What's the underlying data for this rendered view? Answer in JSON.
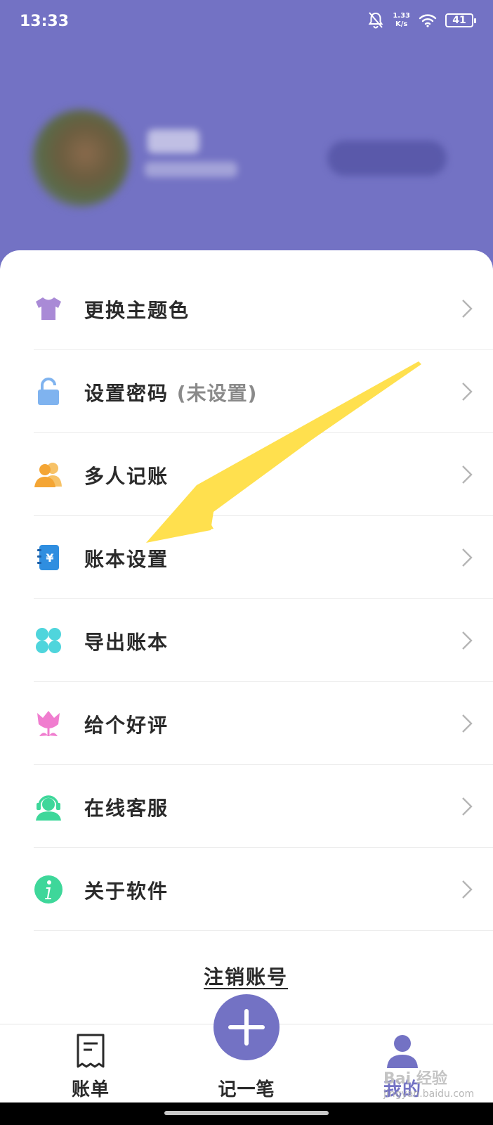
{
  "status_bar": {
    "time": "13:33",
    "net_speed_value": "1.33",
    "net_speed_unit": "K/s",
    "battery": "41"
  },
  "profile": {
    "name": "",
    "subtitle": "",
    "button_label": ""
  },
  "menu": {
    "items": [
      {
        "label": "更换主题色",
        "extra": "",
        "icon": "tshirt-icon",
        "color": "#a98ad6"
      },
      {
        "label": "设置密码",
        "extra": "(未设置)",
        "icon": "lock-icon",
        "color": "#7fb3ef"
      },
      {
        "label": "多人记账",
        "extra": "",
        "icon": "users-icon",
        "color": "#f4b04a"
      },
      {
        "label": "账本设置",
        "extra": "",
        "icon": "ledger-icon",
        "color": "#2f8ee0"
      },
      {
        "label": "导出账本",
        "extra": "",
        "icon": "clover-icon",
        "color": "#4fd5dc"
      },
      {
        "label": "给个好评",
        "extra": "",
        "icon": "tulip-icon",
        "color": "#f07dcf"
      },
      {
        "label": "在线客服",
        "extra": "",
        "icon": "headset-icon",
        "color": "#3ed79a"
      },
      {
        "label": "关于软件",
        "extra": "",
        "icon": "info-icon",
        "color": "#3ed79a"
      }
    ]
  },
  "logout_label": "注销账号",
  "tab_bar": {
    "tabs": [
      {
        "label": "账单",
        "icon": "bill-icon"
      },
      {
        "label": "记一笔",
        "icon": "plus-icon"
      },
      {
        "label": "我的",
        "icon": "user-icon"
      }
    ]
  },
  "watermark": {
    "brand": "Bai 经验",
    "url": "jingyan.baidu.com"
  },
  "colors": {
    "primary": "#7372c4",
    "annotation_arrow": "#ffe04e"
  }
}
